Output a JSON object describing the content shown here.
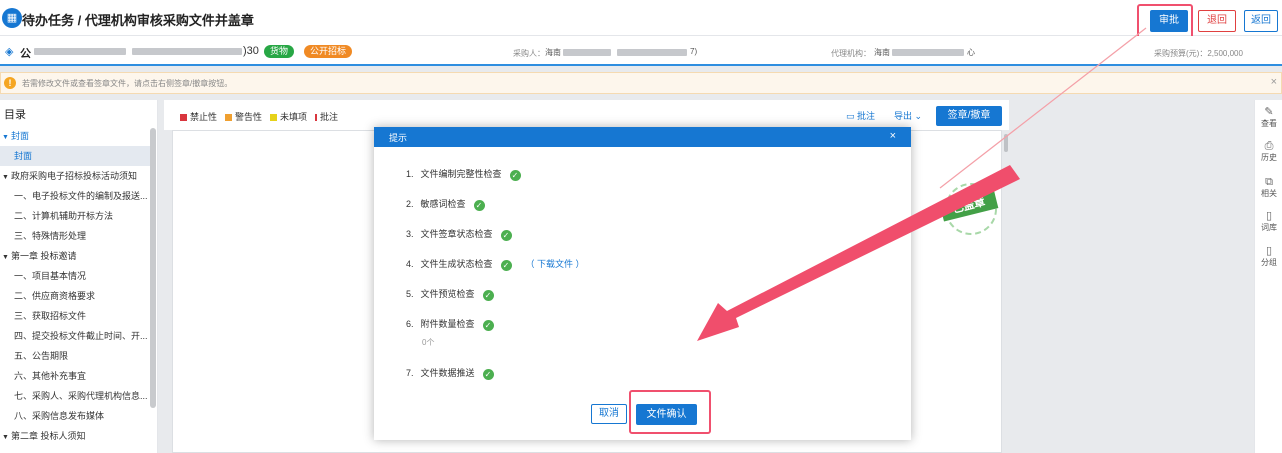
{
  "header": {
    "title": "待办任务 / 代理机构审核采购文件并盖章",
    "approve_label": "审批",
    "return_label": "退回",
    "back_label": "返回"
  },
  "project": {
    "name_prefix": "公",
    "number_suffix": ")30",
    "tag_goods": "货物",
    "tag_open": "公开招标",
    "purchaser_label": "采购人：",
    "purchaser_prefix": "海南",
    "purchaser_suffix": "7)",
    "agency_label": "代理机构：",
    "agency_prefix": "海南",
    "agency_suffix": "心",
    "budget_text": "采购预算(元)：2,500,000"
  },
  "notice": {
    "message": "若需修改文件或查看签章文件，请点击右侧签章/撤章按钮。",
    "close": "×"
  },
  "sidebar": {
    "title": "目录",
    "items": [
      {
        "label": "封面",
        "level": 0,
        "expanded": true,
        "blue": true
      },
      {
        "label": "封面",
        "level": 1,
        "active": true
      },
      {
        "label": "政府采购电子招标投标活动须知",
        "level": 0,
        "expanded": true
      },
      {
        "label": "一、电子投标文件的编制及报送...",
        "level": 1
      },
      {
        "label": "二、计算机辅助开标方法",
        "level": 1
      },
      {
        "label": "三、特殊情形处理",
        "level": 1
      },
      {
        "label": "第一章 投标邀请",
        "level": 0,
        "expanded": true
      },
      {
        "label": "一、项目基本情况",
        "level": 1
      },
      {
        "label": "二、供应商资格要求",
        "level": 1
      },
      {
        "label": "三、获取招标文件",
        "level": 1
      },
      {
        "label": "四、提交投标文件截止时间、开...",
        "level": 1
      },
      {
        "label": "五、公告期限",
        "level": 1
      },
      {
        "label": "六、其他补充事宜",
        "level": 1
      },
      {
        "label": "七、采购人、采购代理机构信息...",
        "level": 1
      },
      {
        "label": "八、采购信息发布媒体",
        "level": 1
      },
      {
        "label": "第二章 投标人须知",
        "level": 0,
        "expanded": true
      }
    ]
  },
  "legend": [
    {
      "label": "禁止性",
      "color": "#d9363e"
    },
    {
      "label": "警告性",
      "color": "#f0a030"
    },
    {
      "label": "未填项",
      "color": "#e6d21a"
    },
    {
      "label": "批注",
      "color": "#d9363e",
      "bar": true
    }
  ],
  "toolbar": {
    "annotate": "批注",
    "export": "导出",
    "sign": "签章/撤章"
  },
  "seal_text": "已盖章",
  "right_rail": [
    {
      "label": "查看",
      "icon": "edit-icon"
    },
    {
      "label": "历史",
      "icon": "history-icon"
    },
    {
      "label": "相关",
      "icon": "copy-icon"
    },
    {
      "label": "词库",
      "icon": "book-icon"
    },
    {
      "label": "分组",
      "icon": "book-icon"
    }
  ],
  "modal": {
    "title": "提示",
    "close": "×",
    "checks": [
      {
        "num": "1.",
        "label": "文件编制完整性检查",
        "passed": true
      },
      {
        "num": "2.",
        "label": "敏感词检查",
        "passed": true
      },
      {
        "num": "3.",
        "label": "文件签章状态检查",
        "passed": true
      },
      {
        "num": "4.",
        "label": "文件生成状态检查",
        "passed": true,
        "link": "（ 下载文件 ）"
      },
      {
        "num": "5.",
        "label": "文件预览检查",
        "passed": true
      },
      {
        "num": "6.",
        "label": "附件数量检查",
        "passed": true,
        "note": "0个"
      },
      {
        "num": "7.",
        "label": "文件数据推送",
        "passed": true
      }
    ],
    "cancel": "取消",
    "confirm": "文件确认"
  }
}
